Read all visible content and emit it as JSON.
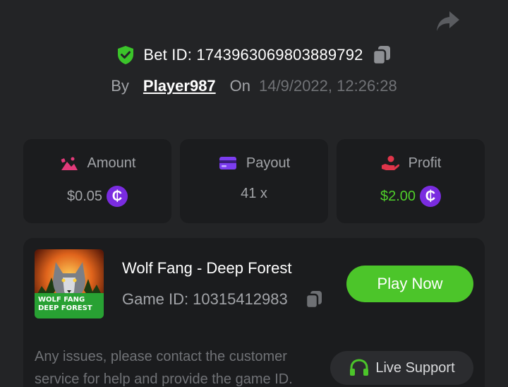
{
  "header": {
    "bet_label": "Bet ID:",
    "bet_id": "1743963069803889792",
    "by_label": "By",
    "player": "Player987",
    "on_label": "On",
    "date": "14/9/2022, 12:26:28"
  },
  "stats": {
    "amount": {
      "label": "Amount",
      "value": "$0.05"
    },
    "payout": {
      "label": "Payout",
      "value": "41 x"
    },
    "profit": {
      "label": "Profit",
      "value": "$2.00"
    }
  },
  "currency_symbol": "₵",
  "game": {
    "title": "Wolf Fang - Deep Forest",
    "id_label": "Game ID:",
    "id": "10315412983",
    "thumb_text_1": "WOLF FANG",
    "thumb_text_2": "DEEP FOREST",
    "play_label": "Play Now"
  },
  "support": {
    "notice": "Any issues, please contact the customer service for help and provide the game ID.",
    "button_label": "Live Support"
  },
  "icons": {
    "share": "share-icon",
    "verified": "shield-check-icon",
    "copy": "copy-icon",
    "amount": "bet-amount-icon",
    "payout": "card-icon",
    "profit": "profit-hand-icon",
    "coin": "coin-icon",
    "support": "headset-icon"
  },
  "colors": {
    "background": "#232426",
    "card": "#1b1c1e",
    "accent_green": "#4cc52a",
    "coin_purple": "#7a2ce0",
    "amount_icon": "#e23a7a",
    "payout_icon": "#7c3df0",
    "profit_icon": "#e0354a"
  }
}
